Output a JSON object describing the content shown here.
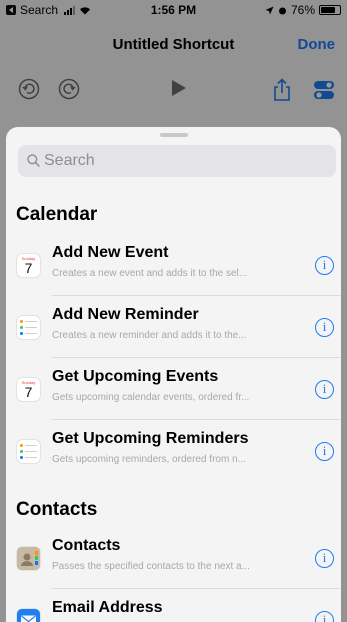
{
  "status_bar": {
    "back_label": "Search",
    "time": "1:56 PM",
    "battery": "76%",
    "battery_level": 0.76
  },
  "nav": {
    "title": "Untitled Shortcut",
    "done": "Done"
  },
  "toolbar": {
    "icons": [
      "undo-icon",
      "redo-icon",
      "play-icon",
      "share-icon",
      "settings-icon"
    ]
  },
  "sheet": {
    "search_placeholder": "Search",
    "sections": [
      {
        "header": "Calendar",
        "items": [
          {
            "title": "Add New Event",
            "description": "Creates a new event and adds it to the sel...",
            "icon": "calendar-icon"
          },
          {
            "title": "Add New Reminder",
            "description": "Creates a new reminder and adds it to the...",
            "icon": "reminders-icon"
          },
          {
            "title": "Get Upcoming Events",
            "description": "Gets upcoming calendar events, ordered fr...",
            "icon": "calendar-icon"
          },
          {
            "title": "Get Upcoming Reminders",
            "description": "Gets upcoming reminders, ordered from n...",
            "icon": "reminders-icon"
          }
        ]
      },
      {
        "header": "Contacts",
        "items": [
          {
            "title": "Contacts",
            "description": "Passes the specified contacts to the next a...",
            "icon": "contacts-icon"
          },
          {
            "title": "Email Address",
            "description": "",
            "icon": "mail-icon"
          }
        ]
      }
    ],
    "calendar_icon": {
      "day": "Sunday",
      "date": "7"
    },
    "info_glyph": "i"
  },
  "colors": {
    "accent": "#1a7cf5",
    "sheet_bg": "#f4f4f5"
  }
}
